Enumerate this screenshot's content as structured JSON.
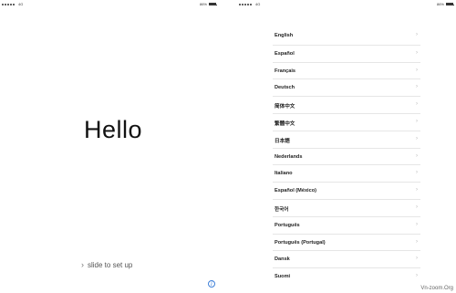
{
  "left": {
    "status": {
      "carrier": "4G",
      "battery": "86%",
      "battery_level": 0.86
    },
    "greeting": "Hello",
    "slide_label": "slide to set up",
    "info_glyph": "i"
  },
  "right": {
    "status": {
      "carrier": "4G",
      "battery": "86%",
      "battery_level": 0.86
    },
    "languages": [
      "English",
      "Español",
      "Français",
      "Deutsch",
      "简体中文",
      "繁體中文",
      "日本語",
      "Nederlands",
      "Italiano",
      "Español (México)",
      "한국어",
      "Português",
      "Português (Portugal)",
      "Dansk",
      "Suomi"
    ]
  },
  "watermark": "Vn-zoom.Org",
  "colors": {
    "accent": "#3d7fd8",
    "separator": "#e6e6e6",
    "chevron": "#b5b5b5"
  },
  "icons": {
    "chevron": "chevron-right-icon",
    "info": "info-icon",
    "battery": "battery-icon",
    "signal": "signal-dots-icon"
  }
}
